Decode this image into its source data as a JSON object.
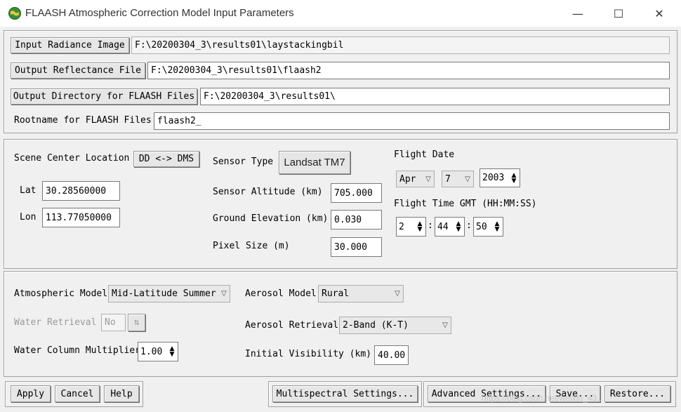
{
  "window": {
    "title": "FLAASH Atmospheric Correction Model Input Parameters",
    "minimize": "—",
    "maximize": "☐",
    "close": "✕"
  },
  "files": {
    "input_button": "Input Radiance Image",
    "input_value": "F:\\20200304_3\\results01\\laystackingbil",
    "output_button": "Output Reflectance File",
    "output_value": "F:\\20200304_3\\results01\\flaash2",
    "outdir_button": "Output Directory for FLAASH Files",
    "outdir_value": "F:\\20200304_3\\results01\\",
    "rootname_label": "Rootname for FLAASH Files",
    "rootname_value": "flaash2_"
  },
  "scene": {
    "center_label": "Scene Center Location",
    "dd_dms_button": "DD <-> DMS",
    "lat_label": "Lat",
    "lat_value": "30.28560000",
    "lon_label": "Lon",
    "lon_value": "113.77050000",
    "sensor_type_label": "Sensor Type",
    "sensor_type_button": "Landsat TM7",
    "sensor_alt_label": "Sensor Altitude (km)",
    "sensor_alt_value": "705.000",
    "ground_elev_label": "Ground Elevation (km)",
    "ground_elev_value": "0.030",
    "pixel_size_label": "Pixel Size (m)",
    "pixel_size_value": "30.000",
    "flight_date_label": "Flight Date",
    "month": "Apr",
    "day": "7",
    "year": "2003",
    "flight_time_label": "Flight Time GMT (HH:MM:SS)",
    "hh": "2",
    "mm": "44",
    "ss": "50",
    "sep1": ":",
    "sep2": ":"
  },
  "atmos": {
    "model_label": "Atmospheric Model",
    "model_value": "Mid-Latitude Summer",
    "water_retrieval_label": "Water Retrieval",
    "water_retrieval_value": "No",
    "water_mult_label": "Water Column Multiplier",
    "water_mult_value": "1.00",
    "aerosol_model_label": "Aerosol Model",
    "aerosol_model_value": "Rural",
    "aerosol_retrieval_label": "Aerosol Retrieval",
    "aerosol_retrieval_value": "2-Band (K-T)",
    "visibility_label": "Initial Visibility (km)",
    "visibility_value": "40.00"
  },
  "footer": {
    "apply": "Apply",
    "cancel": "Cancel",
    "help": "Help",
    "multispectral": "Multispectral Settings...",
    "advanced": "Advanced Settings...",
    "save": "Save...",
    "restore": "Restore..."
  },
  "watermark": "https://blog.csdn.net/weixin_43..."
}
